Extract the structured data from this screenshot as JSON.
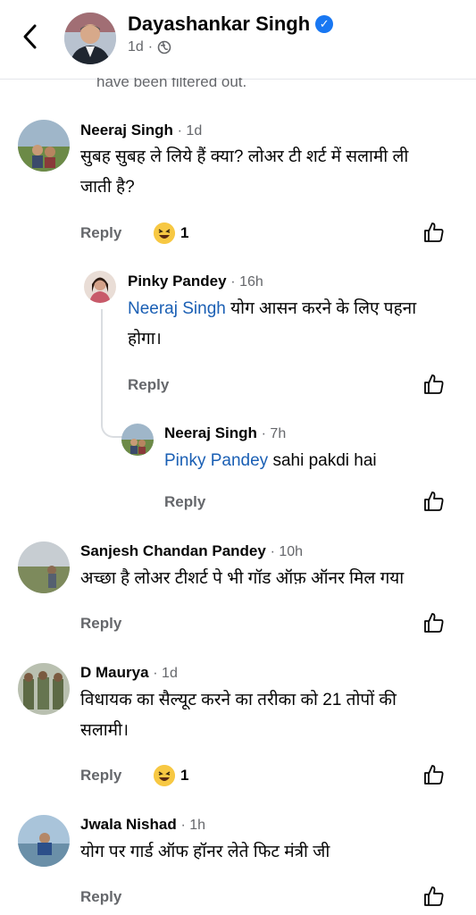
{
  "header": {
    "name": "Dayashankar Singh",
    "meta_time": "1d",
    "meta_sep": "·",
    "filtered_text": "have been filtered out."
  },
  "comments": [
    {
      "name": "Neeraj Singh",
      "time": "· 1d",
      "line1": "सुबह सुबह ले लिये हैं क्या? लोअर टी शर्ट में सलामी ली",
      "line2": "जाती है?",
      "reply": "Reply",
      "reaction_count": "1"
    },
    {
      "name": "Pinky Pandey",
      "time": "· 16h",
      "mention": "Neeraj Singh",
      "line1_rest": " योग आसन करने के लिए पहना",
      "line2": "होगा।",
      "reply": "Reply"
    },
    {
      "name": "Neeraj Singh",
      "time": "· 7h",
      "mention": "Pinky Pandey",
      "text_rest": " sahi pakdi hai",
      "reply": "Reply"
    },
    {
      "name": "Sanjesh Chandan Pandey",
      "time": "· 10h",
      "line1": "अच्छा है लोअर टीशर्ट पे भी गॉड ऑफ़ ऑनर मिल गया",
      "reply": "Reply"
    },
    {
      "name": "D Maurya",
      "time": "· 1d",
      "line1": "विधायक का सैल्यूट करने का तरीका को 21 तोपों की",
      "line2": "सलामी।",
      "reply": "Reply",
      "reaction_count": "1"
    },
    {
      "name": "Jwala Nishad",
      "time": "· 1h",
      "line1": "योग पर गार्ड ऑफ हॉनर लेते फिट मंत्री जी",
      "reply": "Reply"
    }
  ],
  "colors": {
    "link": "#1a5fb4",
    "secondary_text": "#65676b",
    "verified": "#1877f2"
  }
}
